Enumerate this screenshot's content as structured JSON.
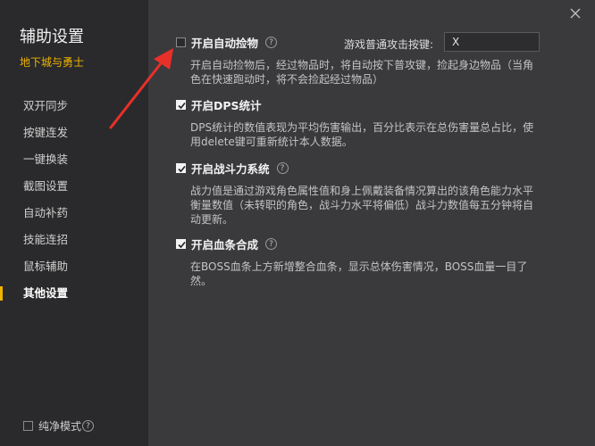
{
  "app": {
    "title": "辅助设置",
    "game": "地下城与勇士"
  },
  "nav": [
    {
      "label": "双开同步",
      "active": false
    },
    {
      "label": "按键连发",
      "active": false
    },
    {
      "label": "一键换装",
      "active": false
    },
    {
      "label": "截图设置",
      "active": false
    },
    {
      "label": "自动补药",
      "active": false
    },
    {
      "label": "技能连招",
      "active": false
    },
    {
      "label": "鼠标辅助",
      "active": false
    },
    {
      "label": "其他设置",
      "active": true
    }
  ],
  "footer": {
    "pure_mode_label": "纯净模式",
    "pure_mode_checked": false
  },
  "attack_key": {
    "label": "游戏普通攻击按键:",
    "value": "X"
  },
  "options": [
    {
      "title": "开启自动捡物",
      "checked": false,
      "desc": "开启自动捡物后，经过物品时，将自动按下普攻键，捡起身边物品（当角色在快速跑动时，将不会捡起经过物品）"
    },
    {
      "title": "开启DPS统计",
      "checked": true,
      "desc": "DPS统计的数值表现为平均伤害输出，百分比表示在总伤害量总占比，使用delete键可重新统计本人数据。"
    },
    {
      "title": "开启战斗力系统",
      "checked": true,
      "desc": "战力值是通过游戏角色属性值和身上佩戴装备情况算出的该角色能力水平衡量数值（未转职的角色，战斗力水平将偏低）战斗力数值每五分钟将自动更新。"
    },
    {
      "title": "开启血条合成",
      "checked": true,
      "desc": "在BOSS血条上方新增整合血条，显示总体伤害情况，BOSS血量一目了然。"
    }
  ],
  "icons": {
    "help": "question-icon",
    "close": "close-icon",
    "arrow": "red-arrow-annotation"
  },
  "colors": {
    "accent": "#f0b400",
    "arrow": "#e8302a"
  }
}
